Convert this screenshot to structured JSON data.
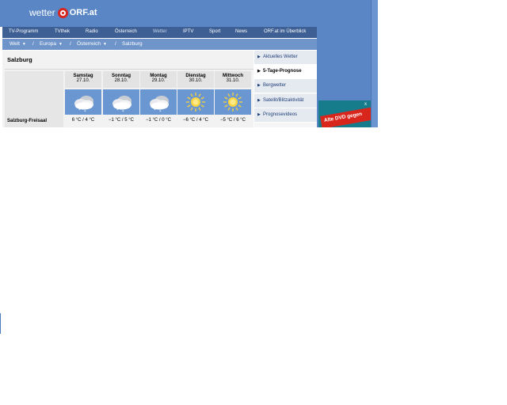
{
  "logo": {
    "wetter": "wetter",
    "orf": "ORF.at"
  },
  "nav": {
    "items": [
      "TV-Programm",
      "TVthek",
      "Radio",
      "Österreich",
      "Wetter",
      "IPTV",
      "Sport",
      "News",
      "ORF.at im Überblick"
    ]
  },
  "breadcrumb": {
    "items": [
      "Welt",
      "Europa",
      "Österreich",
      "Salzburg"
    ],
    "separator": "/",
    "dropdown_glyph": "▼"
  },
  "location": {
    "city": "Salzburg",
    "station": "Salzburg-Freisaal"
  },
  "forecast": [
    {
      "day": "Samstag",
      "date": "27.10.",
      "icon": "cloud-snow-icon",
      "temp": "6 °C / 4 °C"
    },
    {
      "day": "Sonntag",
      "date": "28.10.",
      "icon": "cloud-snow-icon",
      "temp": "−1 °C / 5 °C"
    },
    {
      "day": "Montag",
      "date": "29.10.",
      "icon": "cloud-snow-icon",
      "temp": "−1 °C / 0 °C"
    },
    {
      "day": "Dienstag",
      "date": "30.10.",
      "icon": "sun-icon",
      "temp": "−6 °C / 4 °C"
    },
    {
      "day": "Mittwoch",
      "date": "31.10.",
      "icon": "sun-icon",
      "temp": "−5 °C / 6 °C"
    }
  ],
  "sidebar": {
    "arrow": "▶",
    "items": [
      {
        "label": "Aktuelles Wetter"
      },
      {
        "label": "5-Tage-Prognose"
      },
      {
        "label": "Bergwetter"
      },
      {
        "label": "Satellit/Blitzaktivität"
      },
      {
        "label": "Prognosevideos"
      }
    ],
    "active_index": 1
  },
  "ad": {
    "text": "Alte DVD gegen",
    "close": "x"
  },
  "colors": {
    "header_blue": "#5a86c6",
    "nav_dark": "#3d5f94",
    "breadcrumb_blue": "#6e94c9",
    "icon_tile": "#6a96d2",
    "logo_red": "#d7251f",
    "ad_teal": "#167b8a",
    "ad_red": "#d8261d"
  }
}
